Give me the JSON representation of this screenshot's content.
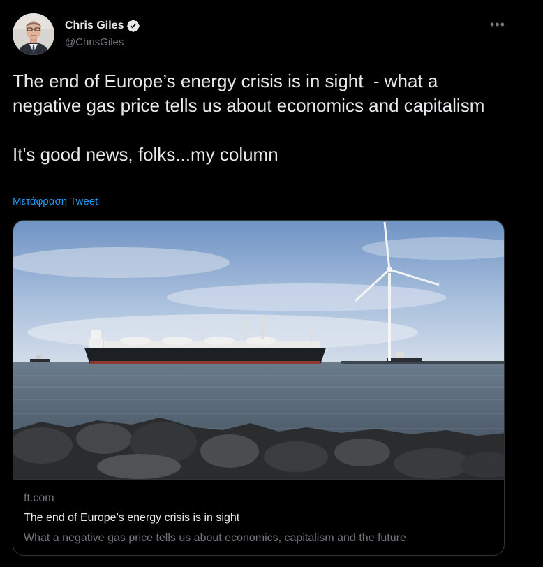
{
  "author": {
    "name": "Chris Giles",
    "handle": "@ChrisGiles_",
    "verified": true,
    "avatar_icon": "user-avatar-photo"
  },
  "tweet": {
    "text": "The end of Europe’s energy crisis is in sight  - what a negative gas price tells us about economics and capitalism\n\nIt's good news, folks...my column",
    "translate_label": "Μετάφραση Tweet",
    "more_icon": "more-horizontal-icon"
  },
  "card": {
    "domain": "ft.com",
    "title": "The end of Europe’s energy crisis is in sight",
    "description": "What a negative gas price tells us about economics, capitalism and the future",
    "image_icon": "lng-tanker-wind-turbine-photo"
  },
  "colors": {
    "background": "#000000",
    "text_primary": "#e7e9ea",
    "text_secondary": "#71767b",
    "link": "#1d9bf0",
    "border": "#2f3336",
    "verified_badge": "#e7e9ea"
  }
}
